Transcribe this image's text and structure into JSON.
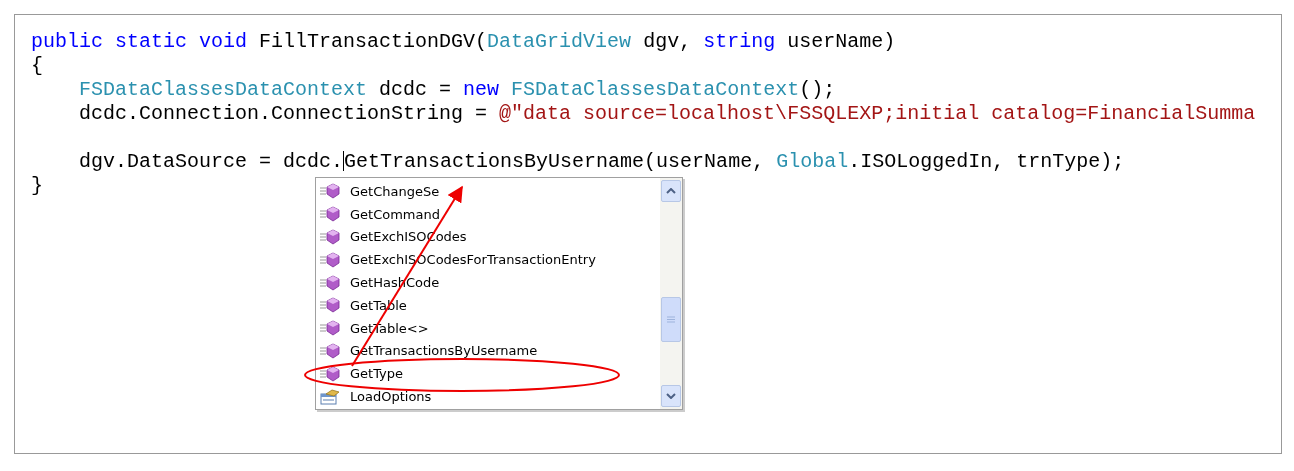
{
  "code": {
    "lines": [
      {
        "kind": "code",
        "tokens": [
          {
            "text": "public static void ",
            "kind": "keyword"
          },
          {
            "text": "FillTransactionDGV(",
            "kind": "plain"
          },
          {
            "text": "DataGridView",
            "kind": "type"
          },
          {
            "text": " dgv, ",
            "kind": "plain"
          },
          {
            "text": "string",
            "kind": "keyword"
          },
          {
            "text": " userName)",
            "kind": "plain"
          }
        ]
      },
      {
        "kind": "code",
        "tokens": [
          {
            "text": "{",
            "kind": "plain"
          }
        ]
      },
      {
        "kind": "code",
        "tokens": [
          {
            "text": "    FSDataClassesDataContext",
            "kind": "type"
          },
          {
            "text": " dcdc = ",
            "kind": "plain"
          },
          {
            "text": "new ",
            "kind": "keyword"
          },
          {
            "text": "FSDataClassesDataContext",
            "kind": "type"
          },
          {
            "text": "();",
            "kind": "plain"
          }
        ]
      },
      {
        "kind": "code",
        "tokens": [
          {
            "text": "    dcdc.Connection.ConnectionString = ",
            "kind": "plain"
          },
          {
            "text": "@\"data source=localhost\\FSSQLEXP;initial catalog=FinancialSumma",
            "kind": "string"
          }
        ]
      },
      {
        "kind": "blank"
      },
      {
        "kind": "code",
        "tokens": [
          {
            "text": "    dgv.DataSource = dcdc.",
            "kind": "plain",
            "caret": true
          },
          {
            "text": "GetTransactionsByUsername(userName, ",
            "kind": "plain"
          },
          {
            "text": "Global",
            "kind": "type"
          },
          {
            "text": ".ISOLoggedIn, trnType);",
            "kind": "plain"
          }
        ]
      },
      {
        "kind": "code",
        "tokens": [
          {
            "text": "}",
            "kind": "plain"
          }
        ]
      }
    ]
  },
  "completion_list": {
    "items": [
      {
        "label": "GetChangeSe",
        "kind": "method"
      },
      {
        "label": "GetCommand",
        "kind": "method"
      },
      {
        "label": "GetExchISOCodes",
        "kind": "method"
      },
      {
        "label": "GetExchISOCodesForTransactionEntry",
        "kind": "method"
      },
      {
        "label": "GetHashCode",
        "kind": "method"
      },
      {
        "label": "GetTable",
        "kind": "method"
      },
      {
        "label": "GetTable<>",
        "kind": "method"
      },
      {
        "label": "GetTransactionsByUsername",
        "kind": "method"
      },
      {
        "label": "GetType",
        "kind": "method"
      },
      {
        "label": "LoadOptions",
        "kind": "property"
      }
    ]
  }
}
